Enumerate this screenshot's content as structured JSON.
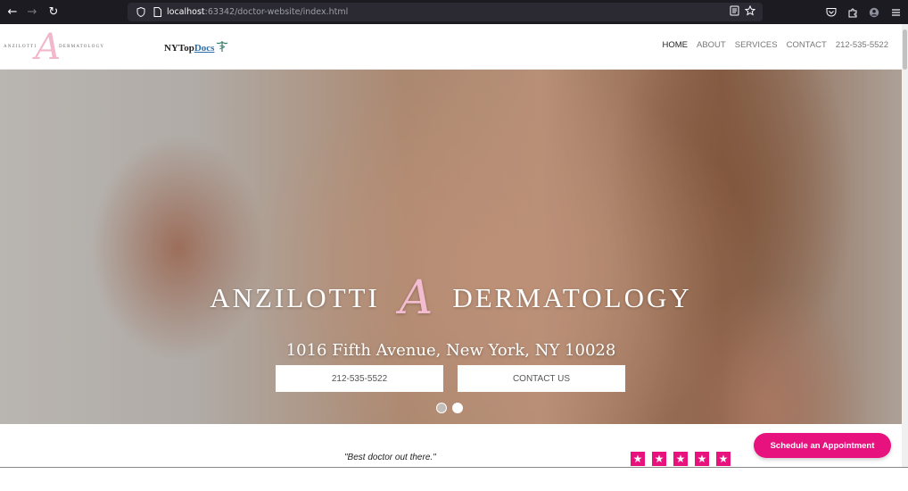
{
  "browser": {
    "url_host": "localhost",
    "url_path": ":63342/doctor-website/index.html"
  },
  "header": {
    "logo_left": "ANZILOTTI",
    "logo_mark": "A",
    "logo_right": "DERMATOLOGY",
    "partner_prefix": "NYTop",
    "partner_suffix": "Docs",
    "nav": [
      {
        "label": "HOME",
        "active": true
      },
      {
        "label": "ABOUT"
      },
      {
        "label": "SERVICES"
      },
      {
        "label": "CONTACT"
      },
      {
        "label": "212-535-5522"
      }
    ]
  },
  "hero": {
    "title_left": "ANZILOTTI",
    "title_mark": "A",
    "title_right": "DERMATOLOGY",
    "address": "1016 Fifth Avenue, New York, NY 10028",
    "phone_button": "212-535-5522",
    "contact_button": "CONTACT US",
    "slides_count": 2,
    "active_slide": 2
  },
  "review": {
    "quote": "\"Best doctor out there.\"",
    "rating": 5
  },
  "cta": {
    "schedule": "Schedule an Appointment"
  },
  "colors": {
    "accent_pink": "#e8127f",
    "logo_pink": "#f1b7cb",
    "browser_bg": "#1c1b22"
  }
}
